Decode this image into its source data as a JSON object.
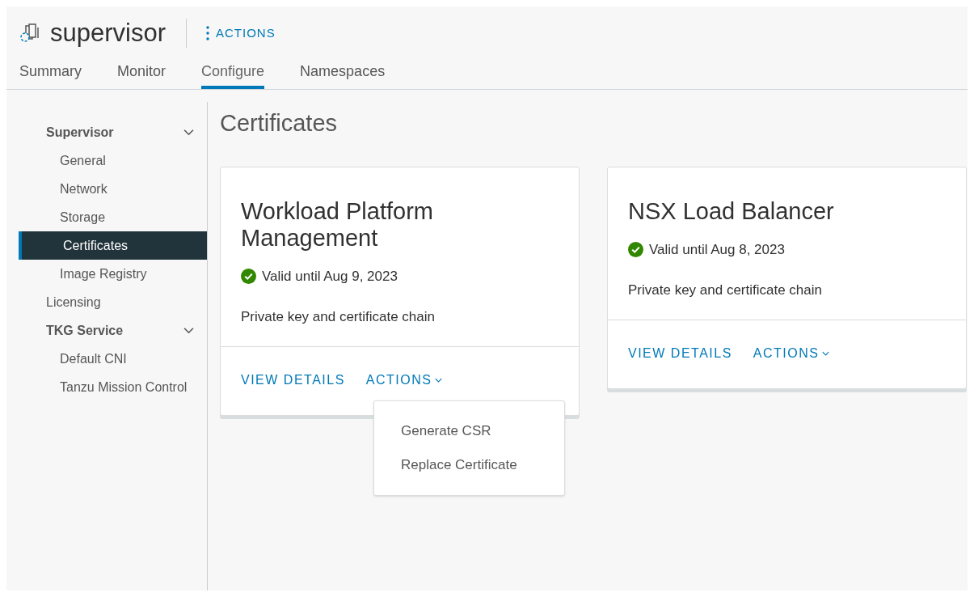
{
  "header": {
    "title": "supervisor",
    "actions_label": "ACTIONS"
  },
  "tabs": [
    {
      "label": "Summary",
      "selected": false
    },
    {
      "label": "Monitor",
      "selected": false
    },
    {
      "label": "Configure",
      "selected": true
    },
    {
      "label": "Namespaces",
      "selected": false
    }
  ],
  "sidebar": {
    "items": [
      {
        "label": "Supervisor",
        "expanded": true,
        "selected": false,
        "children": [
          {
            "label": "General",
            "selected": false
          },
          {
            "label": "Network",
            "selected": false
          },
          {
            "label": "Storage",
            "selected": false
          },
          {
            "label": "Certificates",
            "selected": true
          },
          {
            "label": "Image Registry",
            "selected": false
          }
        ]
      },
      {
        "label": "Licensing",
        "selected": false
      },
      {
        "label": "TKG Service",
        "expanded": true,
        "selected": false,
        "children": [
          {
            "label": "Default CNI",
            "selected": false
          },
          {
            "label": "Tanzu Mission Control",
            "selected": false
          }
        ]
      }
    ]
  },
  "page_title": "Certificates",
  "cards": [
    {
      "title": "Workload Platform Management",
      "status": "Valid until Aug 9, 2023",
      "description": "Private key and certificate chain",
      "view_details": "VIEW DETAILS",
      "actions": "ACTIONS",
      "menu_items": [
        "Generate CSR",
        "Replace Certificate"
      ]
    },
    {
      "title": "NSX Load Balancer",
      "status": "Valid until Aug 8, 2023",
      "description": "Private key and certificate chain",
      "view_details": "VIEW DETAILS",
      "actions": "ACTIONS"
    }
  ]
}
